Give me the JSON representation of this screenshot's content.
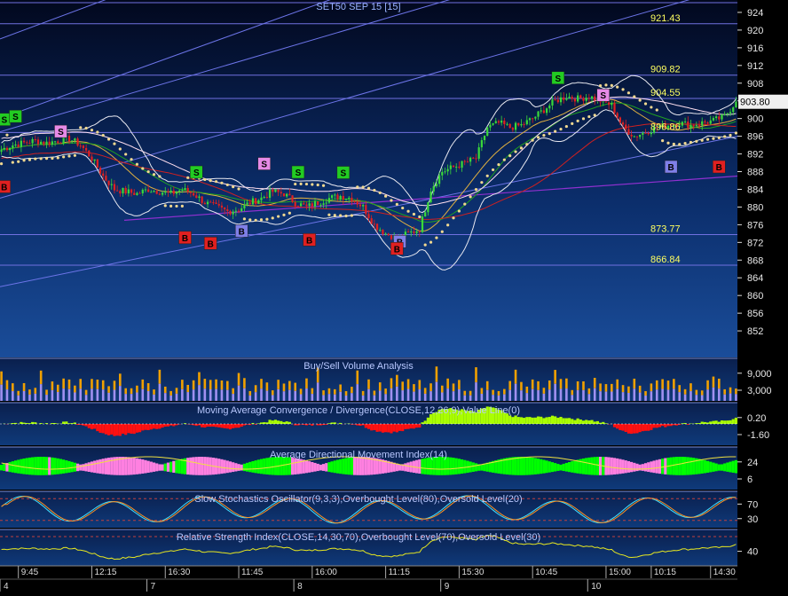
{
  "chart_data": {
    "type": "candlestick",
    "title": "SET50 SEP 15   [15]",
    "price_axis": {
      "ylim": [
        846,
        926.8
      ],
      "ticks": [
        852,
        856,
        860,
        864,
        868,
        872,
        876,
        880,
        884,
        888,
        892,
        896,
        900,
        904,
        908,
        912,
        916,
        920,
        924
      ],
      "current_price": "903.80"
    },
    "levels": [
      {
        "label": "921.43",
        "value": 921.43
      },
      {
        "label": "909.82",
        "value": 909.82
      },
      {
        "label": "904.55",
        "value": 904.55
      },
      {
        "label": "896.86",
        "value": 896.86
      },
      {
        "label": "873.77",
        "value": 873.77
      },
      {
        "label": "866.84",
        "value": 866.84
      }
    ],
    "price_path": [
      [
        0,
        893
      ],
      [
        4,
        894
      ],
      [
        8,
        894.5
      ],
      [
        12,
        895
      ],
      [
        16,
        894.5
      ],
      [
        20,
        895
      ],
      [
        24,
        895.5
      ],
      [
        28,
        894
      ],
      [
        32,
        891
      ],
      [
        36,
        887
      ],
      [
        40,
        884
      ],
      [
        44,
        883.5
      ],
      [
        48,
        883
      ],
      [
        52,
        884
      ],
      [
        56,
        883.5
      ],
      [
        60,
        883
      ],
      [
        64,
        884
      ],
      [
        68,
        883
      ],
      [
        72,
        881
      ],
      [
        76,
        880
      ],
      [
        80,
        879
      ],
      [
        84,
        879.5
      ],
      [
        88,
        881
      ],
      [
        92,
        882
      ],
      [
        96,
        883.5
      ],
      [
        100,
        883
      ],
      [
        104,
        881
      ],
      [
        108,
        880
      ],
      [
        112,
        881
      ],
      [
        116,
        882
      ],
      [
        120,
        882.5
      ],
      [
        124,
        882
      ],
      [
        128,
        880
      ],
      [
        132,
        876
      ],
      [
        136,
        874
      ],
      [
        140,
        873
      ],
      [
        144,
        874
      ],
      [
        148,
        875
      ],
      [
        152,
        884
      ],
      [
        156,
        888
      ],
      [
        160,
        889
      ],
      [
        164,
        890
      ],
      [
        168,
        891
      ],
      [
        172,
        898
      ],
      [
        176,
        899
      ],
      [
        180,
        898
      ],
      [
        184,
        898.5
      ],
      [
        188,
        900
      ],
      [
        192,
        902
      ],
      [
        196,
        904
      ],
      [
        200,
        905
      ],
      [
        204,
        904.5
      ],
      [
        208,
        905
      ],
      [
        212,
        904
      ],
      [
        216,
        903
      ],
      [
        220,
        898
      ],
      [
        224,
        896
      ],
      [
        228,
        897
      ],
      [
        232,
        898
      ],
      [
        236,
        898.5
      ],
      [
        240,
        899
      ],
      [
        244,
        898.5
      ],
      [
        248,
        899
      ],
      [
        252,
        899.5
      ],
      [
        256,
        900.5
      ],
      [
        260,
        903.8
      ]
    ],
    "sessions": [
      {
        "start": 0,
        "date": "4",
        "times": [
          "9:45",
          "12:15"
        ]
      },
      {
        "start": 52,
        "date": "7",
        "times": [
          "16:30",
          "11:45"
        ]
      },
      {
        "start": 104,
        "date": "8",
        "times": [
          "16:00",
          "11:15"
        ]
      },
      {
        "start": 156,
        "date": "9",
        "times": [
          "15:30",
          "10:45"
        ]
      },
      {
        "start": 208,
        "date": "10",
        "times": [
          "15:00",
          "10:15",
          "14:30"
        ]
      }
    ],
    "signals": [
      {
        "type": "B",
        "bar": 1,
        "price": 884.6,
        "color": "#e02020"
      },
      {
        "type": "S",
        "bar": 1,
        "price": 899.8,
        "color": "#22cc22"
      },
      {
        "type": "S",
        "bar": 5,
        "price": 900.5,
        "color": "#22cc22"
      },
      {
        "type": "S",
        "bar": 21,
        "price": 897.1,
        "color": "#e68ae6"
      },
      {
        "type": "B",
        "bar": 65,
        "price": 873.1,
        "color": "#e02020"
      },
      {
        "type": "S",
        "bar": 69,
        "price": 887.9,
        "color": "#22cc22"
      },
      {
        "type": "B",
        "bar": 74,
        "price": 871.8,
        "color": "#e02020"
      },
      {
        "type": "B",
        "bar": 85,
        "price": 874.6,
        "color": "#7f7fe8"
      },
      {
        "type": "S",
        "bar": 93,
        "price": 889.8,
        "color": "#e68ae6"
      },
      {
        "type": "S",
        "bar": 105,
        "price": 887.9,
        "color": "#22cc22"
      },
      {
        "type": "B",
        "bar": 109,
        "price": 872.6,
        "color": "#e02020"
      },
      {
        "type": "S",
        "bar": 121,
        "price": 887.8,
        "color": "#22cc22"
      },
      {
        "type": "B",
        "bar": 141,
        "price": 872.2,
        "color": "#7f7fe8"
      },
      {
        "type": "B",
        "bar": 140,
        "price": 870.6,
        "color": "#e02020"
      },
      {
        "type": "S",
        "bar": 197,
        "price": 909.2,
        "color": "#22cc22"
      },
      {
        "type": "S",
        "bar": 213,
        "price": 905.3,
        "color": "#e68ae6"
      },
      {
        "type": "B",
        "bar": 237,
        "price": 889.1,
        "color": "#7f7fe8"
      },
      {
        "type": "B",
        "bar": 254,
        "price": 889.1,
        "color": "#e02020"
      }
    ],
    "panels": [
      {
        "key": "volume",
        "title": "Buy/Sell Volume Analysis",
        "ticks": [
          "9,000",
          "3,000"
        ]
      },
      {
        "key": "macd",
        "title": "Moving Average Convergence / Divergence(CLOSE,12,26,9),Value Line(0)",
        "ticks": [
          "0.20",
          "-1.60"
        ]
      },
      {
        "key": "adx",
        "title": "Average Directional Movement Index(14)",
        "ticks": [
          "24",
          "6"
        ]
      },
      {
        "key": "stoch",
        "title": "Slow Stochastics Oscillator(9,3,3),Overbought Level(80),Oversold Level(20)",
        "ticks": [
          "70",
          "30"
        ]
      },
      {
        "key": "rsi",
        "title": "Relative Strength Index(CLOSE,14,30,70),Overbought Level(70),Oversold Level(30)",
        "ticks": [
          "40"
        ]
      }
    ],
    "colors": {
      "up_candle": "#3ad83a",
      "down_candle": "#e02020",
      "level_line": "#7070e0",
      "level_label": "#ffff60",
      "volume": "#f0a000",
      "volume_top": "#a090f0",
      "macd_pos": "#aaff00",
      "macd_neg": "#ff1010",
      "adx_up": "#00ff00",
      "adx_down": "#ff80e0",
      "stoch_k": "#40e0ff",
      "stoch_d": "#ff9020",
      "rsi": "#e8e820",
      "dots": "#f0d890"
    }
  }
}
